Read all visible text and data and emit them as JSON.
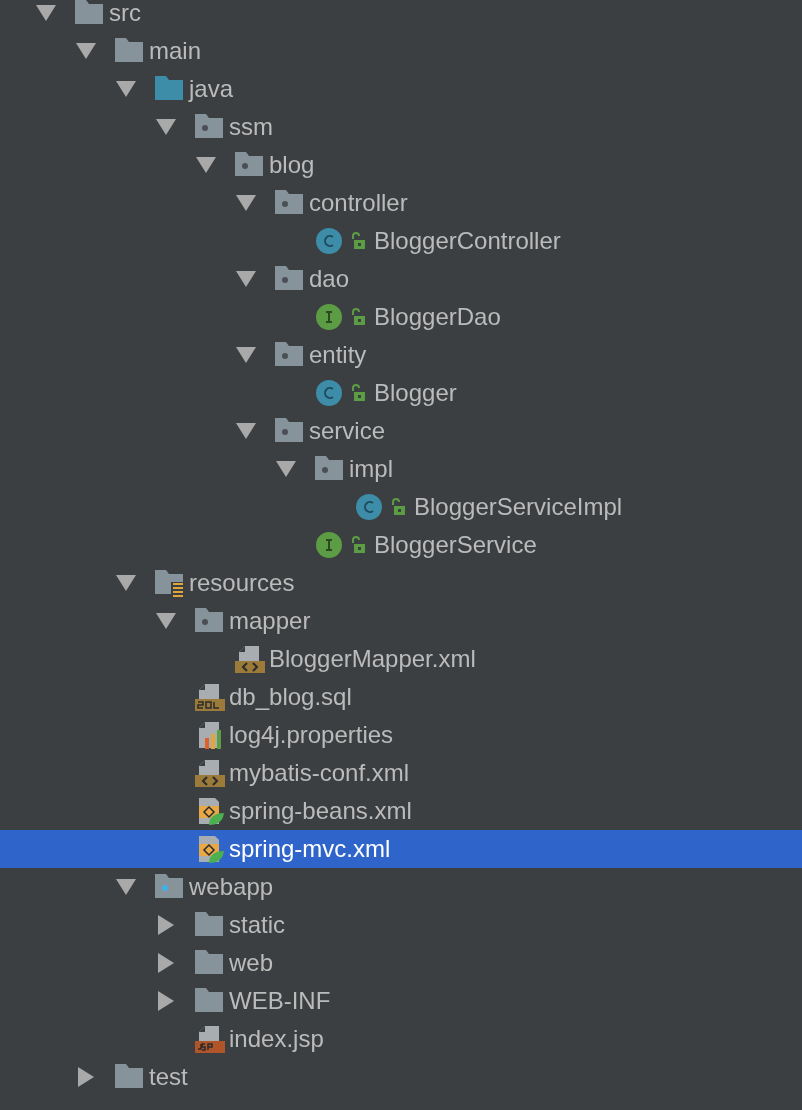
{
  "tree": [
    {
      "label": "src",
      "kind": "folder",
      "expanded": true,
      "selected": false,
      "children": [
        {
          "label": "main",
          "kind": "folder",
          "expanded": true,
          "selected": false,
          "children": [
            {
              "label": "java",
              "kind": "source-folder",
              "expanded": true,
              "selected": false,
              "children": [
                {
                  "label": "ssm",
                  "kind": "package",
                  "expanded": true,
                  "selected": false,
                  "children": [
                    {
                      "label": "blog",
                      "kind": "package",
                      "expanded": true,
                      "selected": false,
                      "children": [
                        {
                          "label": "controller",
                          "kind": "package",
                          "expanded": true,
                          "selected": false,
                          "children": [
                            {
                              "label": "BloggerController",
                              "kind": "class",
                              "public": true,
                              "selected": false
                            }
                          ]
                        },
                        {
                          "label": "dao",
                          "kind": "package",
                          "expanded": true,
                          "selected": false,
                          "children": [
                            {
                              "label": "BloggerDao",
                              "kind": "interface",
                              "public": true,
                              "selected": false
                            }
                          ]
                        },
                        {
                          "label": "entity",
                          "kind": "package",
                          "expanded": true,
                          "selected": false,
                          "children": [
                            {
                              "label": "Blogger",
                              "kind": "class",
                              "public": true,
                              "selected": false
                            }
                          ]
                        },
                        {
                          "label": "service",
                          "kind": "package",
                          "expanded": true,
                          "selected": false,
                          "children": [
                            {
                              "label": "impl",
                              "kind": "package",
                              "expanded": true,
                              "selected": false,
                              "children": [
                                {
                                  "label": "BloggerServiceImpl",
                                  "kind": "class",
                                  "public": true,
                                  "selected": false
                                }
                              ]
                            },
                            {
                              "label": "BloggerService",
                              "kind": "interface",
                              "public": true,
                              "selected": false
                            }
                          ]
                        }
                      ]
                    }
                  ]
                }
              ]
            },
            {
              "label": "resources",
              "kind": "resources-folder",
              "expanded": true,
              "selected": false,
              "children": [
                {
                  "label": "mapper",
                  "kind": "package",
                  "expanded": true,
                  "selected": false,
                  "children": [
                    {
                      "label": "BloggerMapper.xml",
                      "kind": "xml",
                      "selected": false
                    }
                  ]
                },
                {
                  "label": "db_blog.sql",
                  "kind": "sql",
                  "selected": false
                },
                {
                  "label": "log4j.properties",
                  "kind": "properties",
                  "selected": false
                },
                {
                  "label": "mybatis-conf.xml",
                  "kind": "xml",
                  "selected": false
                },
                {
                  "label": "spring-beans.xml",
                  "kind": "spring-xml",
                  "selected": false
                },
                {
                  "label": "spring-mvc.xml",
                  "kind": "spring-xml",
                  "selected": true
                }
              ]
            },
            {
              "label": "webapp",
              "kind": "web-folder",
              "expanded": true,
              "selected": false,
              "children": [
                {
                  "label": "static",
                  "kind": "folder",
                  "expanded": false,
                  "selected": false
                },
                {
                  "label": "web",
                  "kind": "folder",
                  "expanded": false,
                  "selected": false
                },
                {
                  "label": "WEB-INF",
                  "kind": "folder",
                  "expanded": false,
                  "selected": false
                },
                {
                  "label": "index.jsp",
                  "kind": "jsp",
                  "selected": false
                }
              ]
            }
          ]
        },
        {
          "label": "test",
          "kind": "folder",
          "expanded": false,
          "selected": false
        }
      ]
    }
  ]
}
